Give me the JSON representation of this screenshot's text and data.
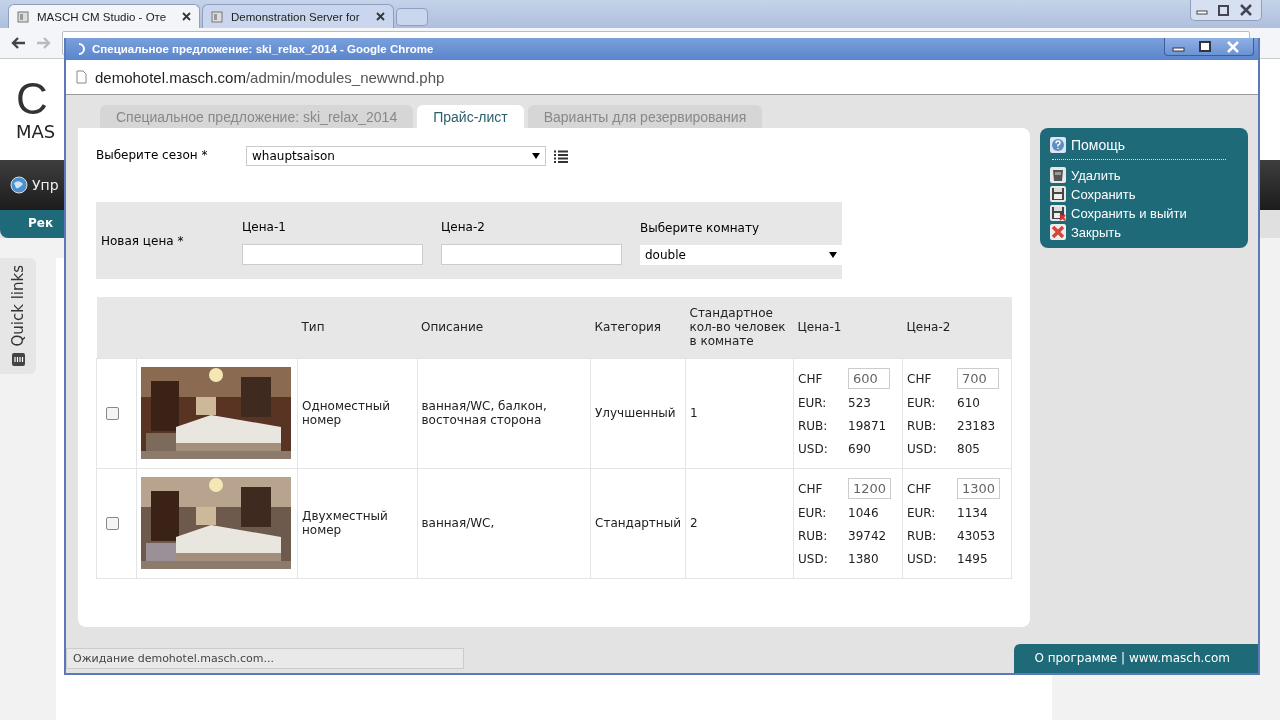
{
  "browser": {
    "tabs": [
      {
        "title": "MASCH CM Studio - Оте",
        "selected": true
      },
      {
        "title": "Demonstration Server for",
        "selected": false
      }
    ]
  },
  "background": {
    "logo": "C",
    "logo_sub": "MAS",
    "nav_item": "Упр",
    "subnav_item": "Рек",
    "quick_links": "Quick links"
  },
  "popup": {
    "title": "Специальное предложение: ski_relax_2014 - Google Chrome",
    "url_host": "demohotel.masch.com",
    "url_path": "/admin/modules_newwnd.php",
    "tabs": [
      {
        "label": "Специальное предложение: ski_relax_2014",
        "selected": false
      },
      {
        "label": "Прайс-лист",
        "selected": true
      },
      {
        "label": "Варианты для резервирования",
        "selected": false
      }
    ],
    "season": {
      "label": "Выберите сезон *",
      "value": "whauptsaison"
    },
    "new_price": {
      "label": "Новая цена *",
      "fields": [
        {
          "label": "Цена-1"
        },
        {
          "label": "Цена-2"
        }
      ],
      "room": {
        "label": "Выберите комнату",
        "value": "double"
      }
    },
    "table": {
      "columns": [
        "Тип",
        "Описание",
        "Категория",
        "Стандартное кол-во человек в комнате",
        "Цена-1",
        "Цена-2"
      ],
      "rows": [
        {
          "checked": false,
          "type": "Одноместный номер",
          "description": "ванная/WC, балкон, восточная сторона",
          "category": "Улучшенный",
          "persons": "1",
          "prices": [
            [
              {
                "kind": "input",
                "currency": "CHF",
                "value": "600"
              },
              {
                "kind": "text",
                "currency": "EUR:",
                "value": "523"
              },
              {
                "kind": "text",
                "currency": "RUB:",
                "value": "19871"
              },
              {
                "kind": "text",
                "currency": "USD:",
                "value": "690"
              }
            ],
            [
              {
                "kind": "input",
                "currency": "CHF",
                "value": "700"
              },
              {
                "kind": "text",
                "currency": "EUR:",
                "value": "610"
              },
              {
                "kind": "text",
                "currency": "RUB:",
                "value": "23183"
              },
              {
                "kind": "text",
                "currency": "USD:",
                "value": "805"
              }
            ]
          ]
        },
        {
          "checked": false,
          "type": "Двухместный номер",
          "description": "ванная/WC,",
          "category": "Стандартный",
          "persons": "2",
          "prices": [
            [
              {
                "kind": "input",
                "currency": "CHF",
                "value": "1200"
              },
              {
                "kind": "text",
                "currency": "EUR:",
                "value": "1046"
              },
              {
                "kind": "text",
                "currency": "RUB:",
                "value": "39742"
              },
              {
                "kind": "text",
                "currency": "USD:",
                "value": "1380"
              }
            ],
            [
              {
                "kind": "input",
                "currency": "CHF",
                "value": "1300"
              },
              {
                "kind": "text",
                "currency": "EUR:",
                "value": "1134"
              },
              {
                "kind": "text",
                "currency": "RUB:",
                "value": "43053"
              },
              {
                "kind": "text",
                "currency": "USD:",
                "value": "1495"
              }
            ]
          ]
        }
      ]
    },
    "actions": {
      "help": "Помощь",
      "items": [
        {
          "kind": "delete",
          "label": "Удалить"
        },
        {
          "kind": "save",
          "label": "Сохранить"
        },
        {
          "kind": "save_exit",
          "label": "Сохранить и выйти"
        },
        {
          "kind": "close",
          "label": "Закрыть"
        }
      ]
    },
    "status": "Ожидание demohotel.masch.com...",
    "footer": "О программе | www.masch.com"
  }
}
